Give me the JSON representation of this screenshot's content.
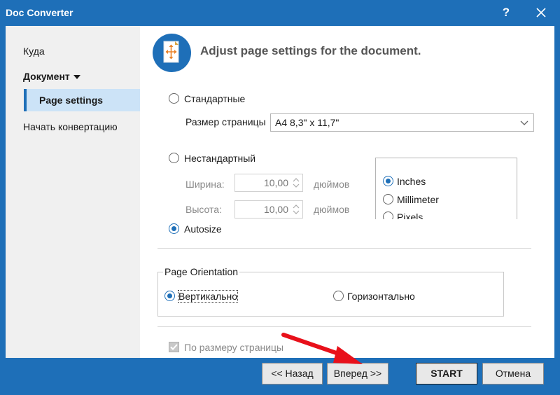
{
  "window": {
    "title": "Doc Converter",
    "help_label": "?"
  },
  "sidebar": {
    "items": [
      {
        "label": "Куда"
      },
      {
        "label": "Документ"
      },
      {
        "label": "Page settings"
      },
      {
        "label": "Начать конвертацию"
      }
    ]
  },
  "header": {
    "title": "Adjust page settings for the document."
  },
  "page_size": {
    "standard_label": "Стандартные",
    "size_label": "Размер страницы",
    "size_value": "A4 8,3\" x 11,7\"",
    "custom_label": "Нестандартный",
    "width_label": "Ширина:",
    "width_value": "10,00",
    "height_label": "Высота:",
    "height_value": "10,00",
    "unit_label_1": "дюймов",
    "unit_label_2": "дюймов",
    "autosize_label": "Autosize",
    "selected": "autosize"
  },
  "units": {
    "options": [
      "Inches",
      "Millimeter",
      "Pixels"
    ],
    "selected": "Inches"
  },
  "orientation": {
    "legend": "Page Orientation",
    "vertical_label": "Вертикально",
    "horizontal_label": "Горизонтально",
    "selected": "vertical"
  },
  "fit_page": {
    "label": "По размеру страницы",
    "checked": true,
    "disabled": true
  },
  "footer": {
    "back_label": "<< Назад",
    "next_label": "Вперед >>",
    "start_label": "START",
    "cancel_label": "Отмена"
  },
  "colors": {
    "accent": "#1e6fb8",
    "annotation_arrow": "#e8101a"
  }
}
